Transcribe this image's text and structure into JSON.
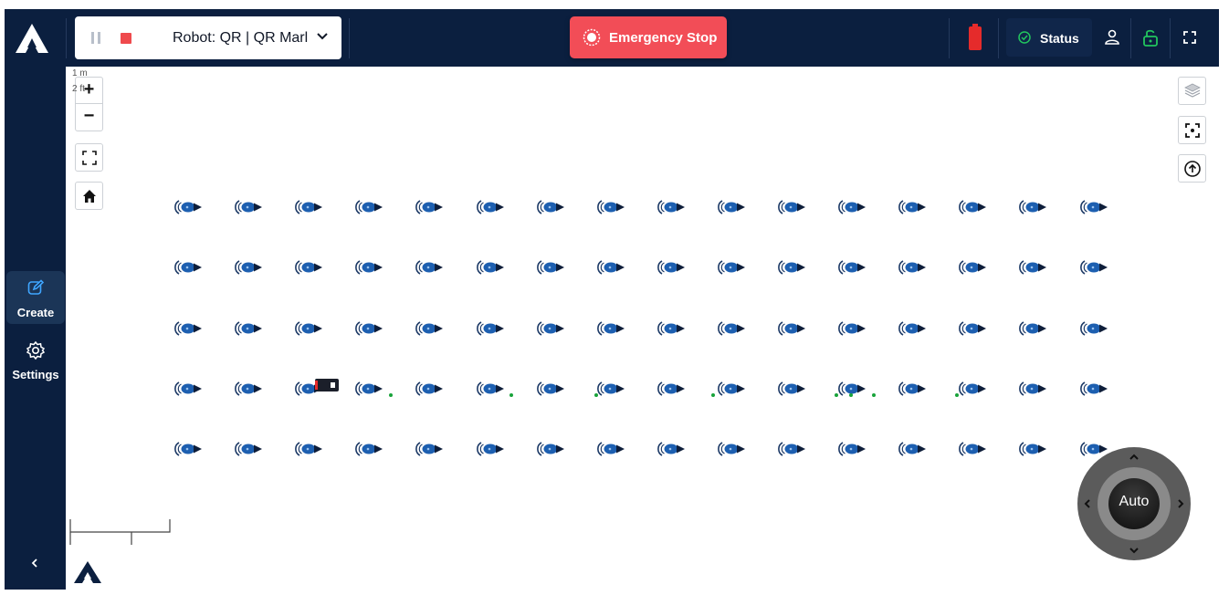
{
  "topbar": {
    "robot_label": "Robot: QR | QR Marl",
    "emergency_stop_label": "Emergency Stop",
    "status_label": "Status"
  },
  "sidebar": {
    "items": [
      {
        "label": "Create",
        "icon": "edit-icon",
        "active": true
      },
      {
        "label": "Settings",
        "icon": "gear-icon",
        "active": false
      }
    ]
  },
  "map": {
    "scale_metric": "1 m",
    "scale_imperial": "2 ft",
    "marker_rows": 5,
    "marker_cols": 16,
    "joystick_label": "Auto"
  },
  "colors": {
    "navy": "#0b1f3f",
    "emergency": "#f24d57",
    "battery": "#e52b2b",
    "status_ok": "#22c55e",
    "marker_blue": "#1d5fb0",
    "path_green": "#18a33a"
  }
}
